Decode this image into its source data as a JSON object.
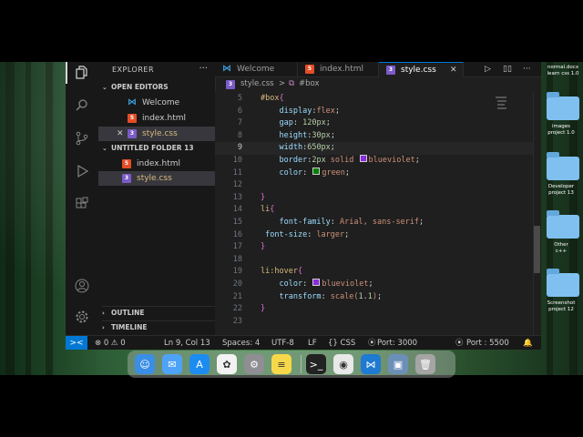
{
  "desktop": {
    "icons": [
      {
        "label": "images\nproject 1.0"
      },
      {
        "label": "Developer\nproject 13"
      },
      {
        "label": "Other\nc++"
      },
      {
        "label": "Screenshot\nproject 12"
      }
    ],
    "top_label": "normal.docx\nlearn css 1.0"
  },
  "vscode": {
    "sidebar": {
      "title": "EXPLORER",
      "more": "···",
      "open_editors_title": "OPEN EDITORS",
      "open_editors": [
        {
          "name": "Welcome",
          "icon": "vscode-icon",
          "color": "#3c99d4"
        },
        {
          "name": "index.html",
          "icon": "html-icon",
          "color": "#e44d26"
        },
        {
          "name": "style.css",
          "icon": "css-icon",
          "color": "#7b5bc7",
          "selected": true
        }
      ],
      "folder_title": "UNTITLED FOLDER 13",
      "folder_files": [
        {
          "name": "index.html",
          "icon": "html-icon",
          "color": "#e44d26"
        },
        {
          "name": "style.css",
          "icon": "css-icon",
          "color": "#7b5bc7",
          "selected": true
        }
      ],
      "outline_title": "OUTLINE",
      "timeline_title": "TIMELINE"
    },
    "tabs": [
      {
        "label": "Welcome",
        "icon": "vscode-icon",
        "color": "#3c99d4"
      },
      {
        "label": "index.html",
        "icon": "html-icon",
        "color": "#e44d26"
      },
      {
        "label": "style.css",
        "icon": "css-icon",
        "color": "#7b5bc7",
        "active": true
      }
    ],
    "breadcrumb": {
      "file": "style.css",
      "separator": ">",
      "symbol": "#box"
    },
    "editor": {
      "current_line": 9,
      "lines": [
        {
          "n": "5",
          "text": "#box{"
        },
        {
          "n": "6",
          "text": "    display:flex;"
        },
        {
          "n": "7",
          "text": "    gap: 120px;"
        },
        {
          "n": "8",
          "text": "    height:30px;"
        },
        {
          "n": "9",
          "text": "    width:650px;"
        },
        {
          "n": "10",
          "text": "    border:2px solid blueviolet;"
        },
        {
          "n": "11",
          "text": "    color: green;"
        },
        {
          "n": "12",
          "text": ""
        },
        {
          "n": "13",
          "text": "}"
        },
        {
          "n": "14",
          "text": "li{"
        },
        {
          "n": "15",
          "text": "    font-family: Arial, sans-serif;"
        },
        {
          "n": "16",
          "text": " font-size: larger;"
        },
        {
          "n": "17",
          "text": "}"
        },
        {
          "n": "18",
          "text": ""
        },
        {
          "n": "19",
          "text": "li:hover{"
        },
        {
          "n": "20",
          "text": "    color: blueviolet;"
        },
        {
          "n": "21",
          "text": "    transform: scale(1.1);"
        },
        {
          "n": "22",
          "text": "}"
        },
        {
          "n": "23",
          "text": ""
        }
      ]
    },
    "statusbar": {
      "remote": "><",
      "problems": "⊗ 0 ⚠ 0",
      "position": "Ln 9, Col 13",
      "spaces": "Spaces: 4",
      "encoding": "UTF-8",
      "eol": "LF",
      "language": "{} CSS",
      "port1": "Port: 3000",
      "port2": "Port : 5500"
    }
  },
  "dock": {
    "apps": [
      {
        "name": "finder",
        "color": "#3a8ee6"
      },
      {
        "name": "mail",
        "color": "#4fa3f7"
      },
      {
        "name": "app-store",
        "color": "#1d8cf0"
      },
      {
        "name": "photos",
        "color": "#f2f2f2"
      },
      {
        "name": "system-settings",
        "color": "#8e8e93"
      },
      {
        "name": "notes",
        "color": "#f7d84a"
      },
      {
        "name": "terminal",
        "color": "#222222"
      },
      {
        "name": "chrome",
        "color": "#e8e8e8"
      },
      {
        "name": "vscode",
        "color": "#1f7ad1"
      },
      {
        "name": "preview",
        "color": "#6c8fb8"
      },
      {
        "name": "trash",
        "color": "#a5a5a5"
      }
    ]
  }
}
